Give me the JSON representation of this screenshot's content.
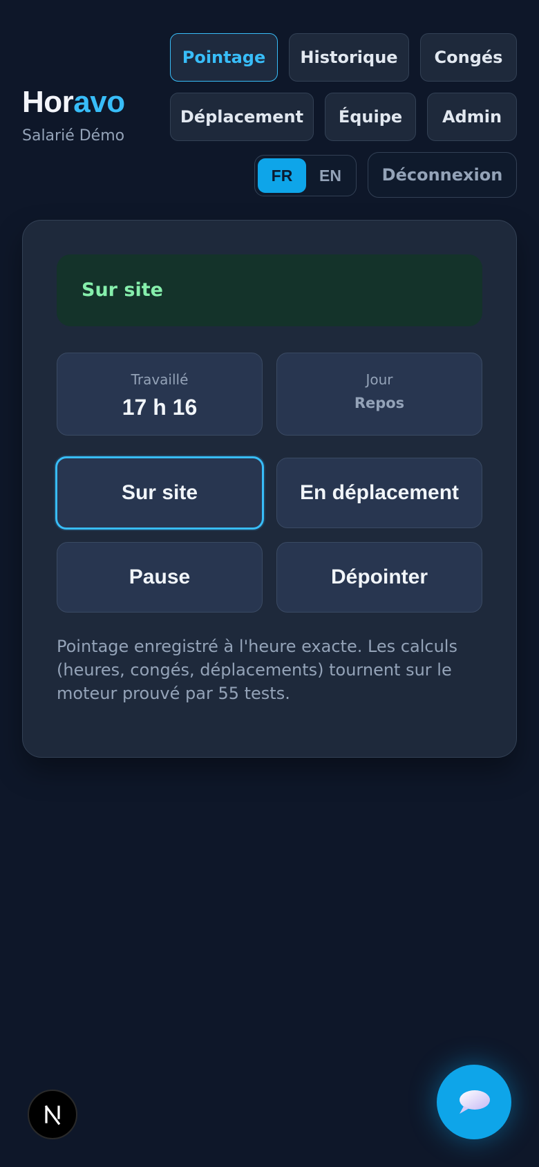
{
  "brand": {
    "name_part1": "Hor",
    "name_part2": "avo",
    "user": "Salarié Démo"
  },
  "nav": {
    "pointage": "Pointage",
    "historique": "Historique",
    "conges": "Congés",
    "deplacement": "Déplacement",
    "equipe": "Équipe",
    "admin": "Admin"
  },
  "lang": {
    "fr": "FR",
    "en": "EN",
    "active": "FR"
  },
  "logout": "Déconnexion",
  "status": {
    "label": "Sur site"
  },
  "stats": {
    "worked": {
      "label": "Travaillé",
      "value": "17 h 16"
    },
    "day": {
      "label": "Jour",
      "value": "Repos"
    }
  },
  "actions": {
    "on_site": "Sur site",
    "travel": "En déplacement",
    "pause": "Pause",
    "clock_out": "Dépointer"
  },
  "note": "Pointage enregistré à l'heure exacte. Les calculs (heures, congés, déplacements) tournent sur le moteur prouvé par 55 tests.",
  "badge": {
    "letter": "N"
  },
  "colors": {
    "accent": "#38bdf8",
    "status_bg": "#14332a",
    "status_text": "#86efac",
    "background": "#0e1729"
  }
}
